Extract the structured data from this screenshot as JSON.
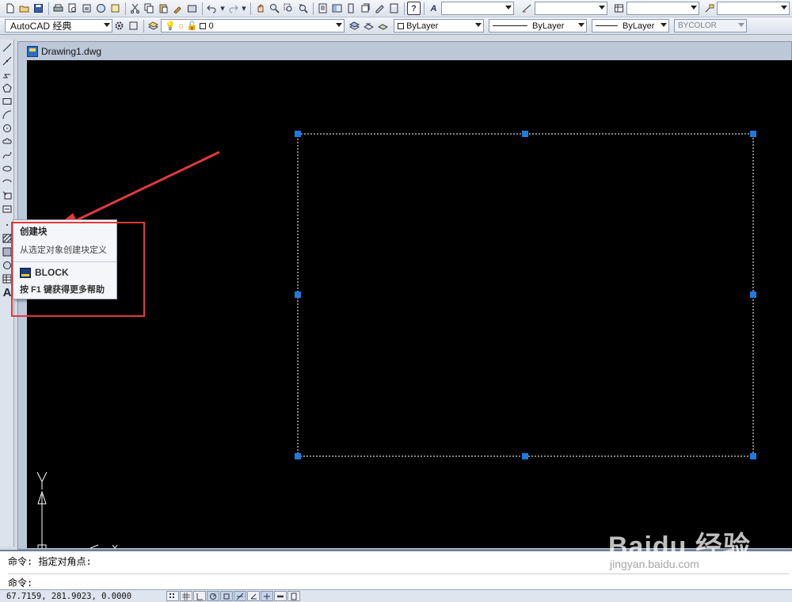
{
  "toolbar": {
    "layer_value": "0",
    "color_value": "ByLayer",
    "linetype_value": "ByLayer",
    "lineweight_value": "ByLayer",
    "plotstyle_value": "BYCOLOR"
  },
  "workspace": {
    "value": "AutoCAD 经典"
  },
  "document": {
    "tab_title": "Drawing1.dwg"
  },
  "tooltip": {
    "title": "创建块",
    "description": "从选定对象创建块定义",
    "command": "BLOCK",
    "help": "按 F1 键获得更多帮助"
  },
  "ucs": {
    "y_label": "Y",
    "x_label": "X"
  },
  "command_line": {
    "history": "命令: 指定对角点:",
    "prompt": "命令:"
  },
  "status": {
    "coordinates": "67.7159,  281.9023, 0.0000"
  },
  "watermark": {
    "brand": "Baidu 经验",
    "url": "jingyan.baidu.com"
  },
  "colors": {
    "canvas": "#000000",
    "grip": "#1f7ae0",
    "annotation": "#e23a3a",
    "selection": "#ffffff"
  },
  "icons": {
    "toolbar1": [
      "new-icon",
      "open-icon",
      "save-icon",
      "print-icon",
      "preview-icon",
      "publish-icon",
      "plot-icon",
      "3ddwf-icon",
      "cut-icon",
      "copy-icon",
      "paste-icon",
      "matchprop-icon",
      "blockeditor-icon",
      "undo-icon",
      "redo-icon",
      "pan-icon",
      "zoom-realtime-icon",
      "zoom-window-icon",
      "zoom-previous-icon",
      "properties-icon",
      "designcenter-icon",
      "toolpalette-icon",
      "sheetset-icon",
      "markup-icon",
      "quickcalc-icon",
      "help-icon"
    ],
    "left": [
      "line-icon",
      "construction-line-icon",
      "polyline-icon",
      "polygon-icon",
      "rectangle-icon",
      "arc-icon",
      "circle-icon",
      "revcloud-icon",
      "spline-icon",
      "ellipse-icon",
      "ellipse-arc-icon",
      "insert-block-icon",
      "make-block-icon",
      "point-icon",
      "hatch-icon",
      "gradient-icon",
      "region-icon",
      "table-icon",
      "multiline-text-icon"
    ],
    "status": [
      "snap-icon",
      "grid-icon",
      "ortho-icon",
      "polar-icon",
      "osnap-icon",
      "otrack-icon",
      "ducs-icon",
      "dyn-icon",
      "lwt-icon",
      "qp-icon"
    ]
  }
}
